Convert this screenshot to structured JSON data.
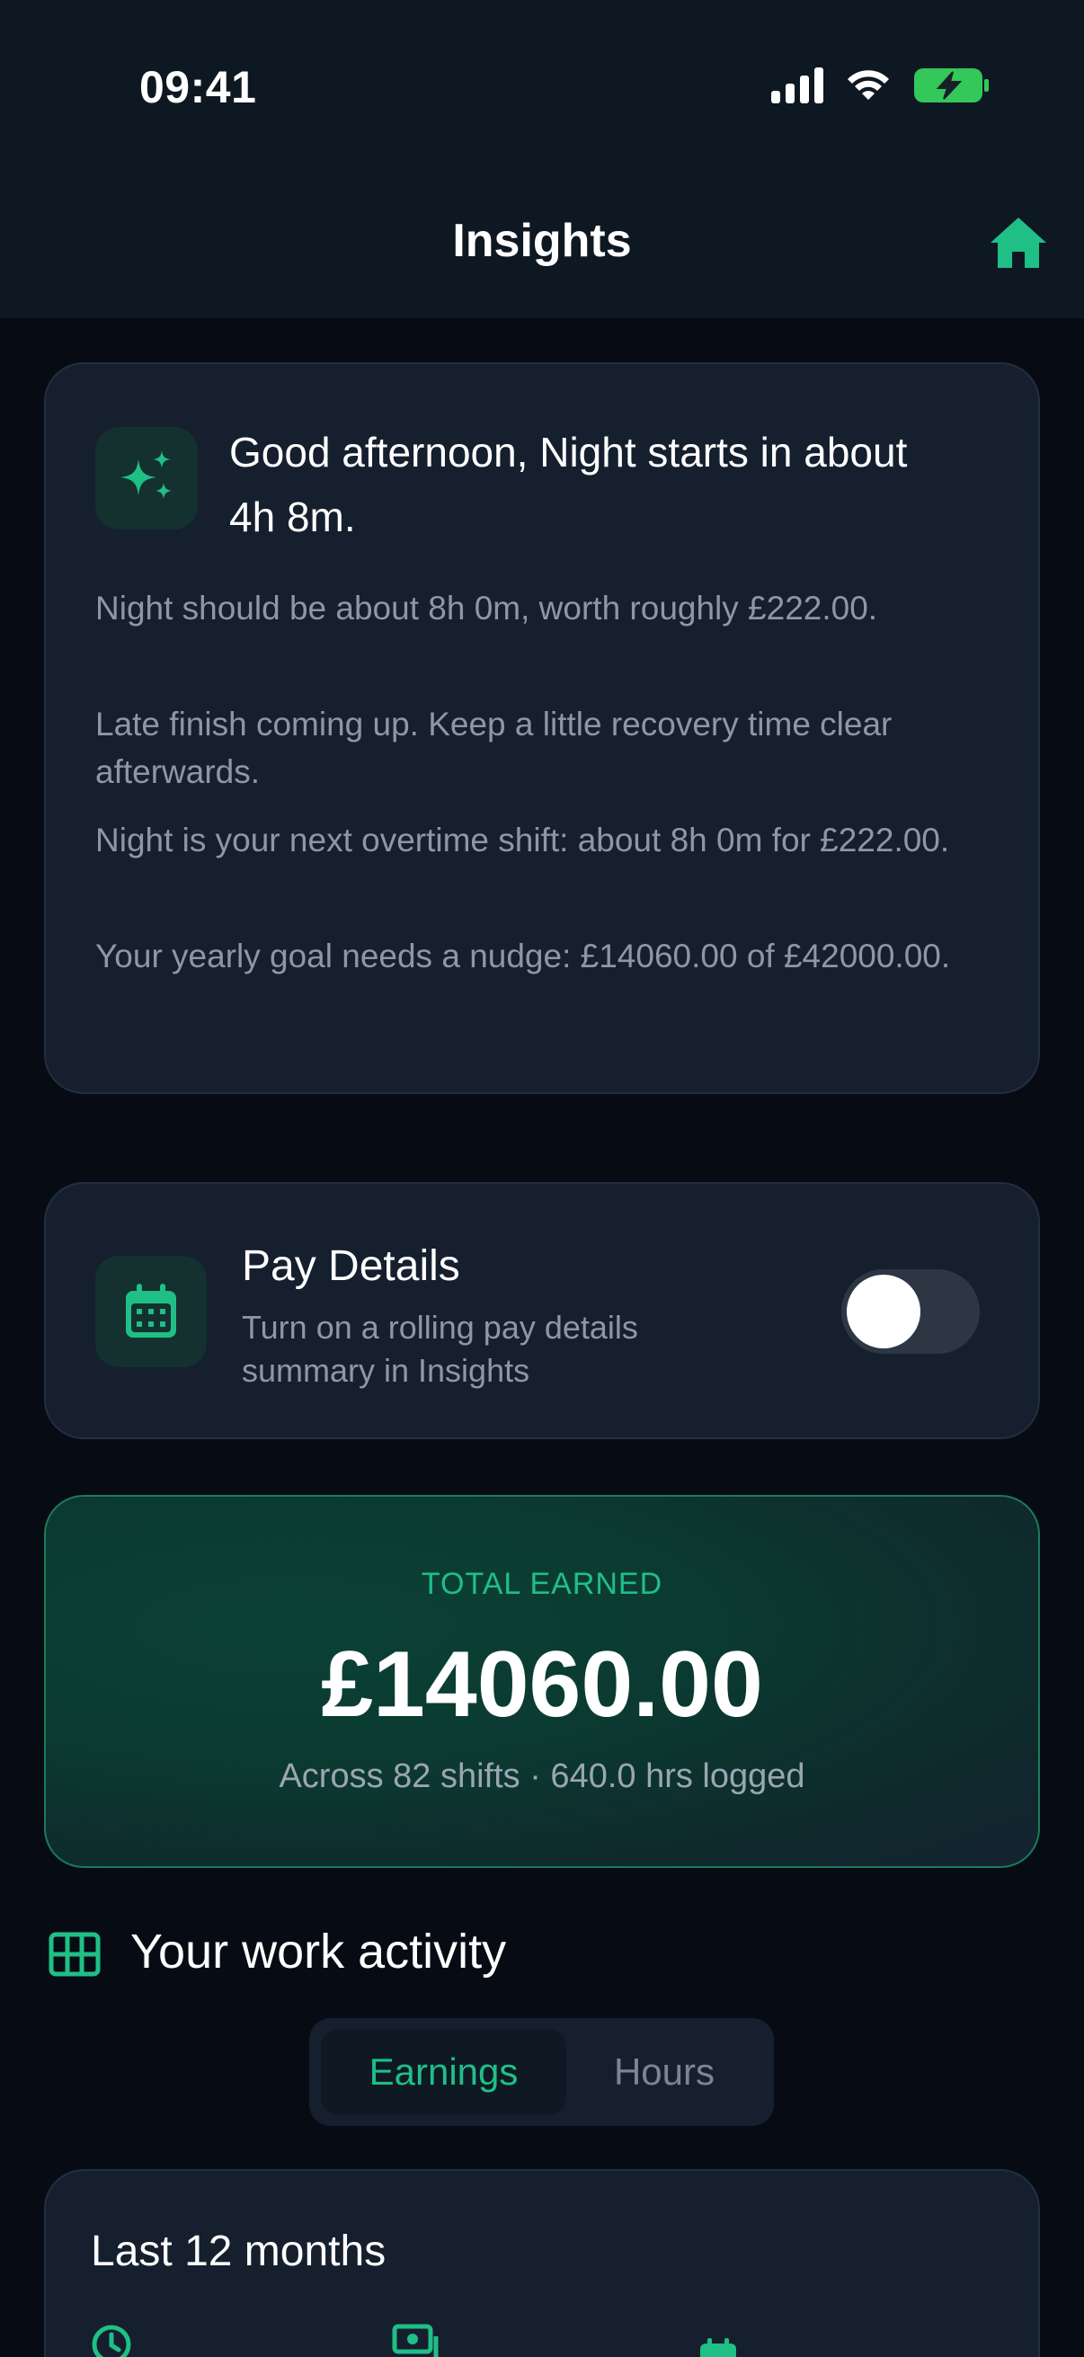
{
  "status_bar": {
    "time": "09:41"
  },
  "nav": {
    "title": "Insights"
  },
  "insight": {
    "title": "Good afternoon, Night starts in about 4h 8m.",
    "lines": [
      "Night should be about 8h 0m, worth roughly £222.00.",
      "Late finish coming up. Keep a little recovery time clear afterwards.",
      "Night is your next overtime shift: about 8h 0m for £222.00.",
      "Your yearly goal needs a nudge: £14060.00 of £42000.00."
    ]
  },
  "pay_details": {
    "title": "Pay Details",
    "subtitle": "Turn on a rolling pay details summary in Insights",
    "enabled": false
  },
  "total_earned": {
    "label": "TOTAL EARNED",
    "amount": "£14060.00",
    "summary": "Across 82 shifts · 640.0 hrs logged"
  },
  "activity": {
    "title": "Your work activity",
    "tabs": [
      "Earnings",
      "Hours"
    ],
    "selected_tab": "Earnings"
  },
  "period_card": {
    "title": "Last 12 months"
  },
  "colors": {
    "accent": "#1fbf86",
    "card": "#151f2e",
    "background": "#070c14"
  }
}
